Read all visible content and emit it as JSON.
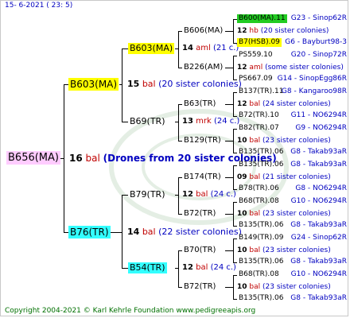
{
  "header": {
    "date": "15-  6-2021 (  23:  5)"
  },
  "footer": {
    "text": "Copyright 2004-2021 © Karl Kehrle Foundation    www.pedigreeapis.org"
  },
  "root": {
    "name": "B656(MA)",
    "num": "16",
    "sp": "bal",
    "col": "(Drones from 20 sister colonies)"
  },
  "g1": [
    {
      "name": "B603(MA)",
      "num": "15",
      "sp": "bal",
      "col": "(20 sister colonies)"
    },
    {
      "name": "B76(TR)",
      "num": "14",
      "sp": "bal",
      "col": "(22 sister colonies)"
    }
  ],
  "g2": [
    {
      "name": "B603(MA)",
      "num": "14",
      "sp": "aml",
      "col": "(21 c.)"
    },
    {
      "name": "B69(TR)",
      "num": "13",
      "sp": "mrk",
      "col": "(24 c.)"
    },
    {
      "name": "B79(TR)",
      "num": "12",
      "sp": "bal",
      "col": "(24 c.)"
    },
    {
      "name": "B54(TR)",
      "num": "12",
      "sp": "bal",
      "col": "(24 c.)"
    }
  ],
  "g3": [
    {
      "name": "B606(MA)",
      "num": "12",
      "sp": "hb",
      "col": "(20 sister colonies)"
    },
    {
      "name": "B226(AM)",
      "num": "12",
      "sp": "aml",
      "col": "(some sister colonies)"
    },
    {
      "name": "B63(TR)",
      "num": "12",
      "sp": "bal",
      "col": "(24 sister colonies)"
    },
    {
      "name": "B129(TR)",
      "num": "10",
      "sp": "bal",
      "col": "(23 sister colonies)"
    },
    {
      "name": "B174(TR)",
      "num": "09",
      "sp": "bal",
      "col": "(21 sister colonies)"
    },
    {
      "name": "B72(TR)",
      "num": "10",
      "sp": "bal",
      "col": "(23 sister colonies)"
    },
    {
      "name": "B70(TR)",
      "num": "10",
      "sp": "bal",
      "col": "(23 sister colonies)"
    },
    {
      "name": "B72(TR)",
      "num": "10",
      "sp": "bal",
      "col": "(23 sister colonies)"
    }
  ],
  "g4": [
    {
      "name": "B600(MA).11",
      "loc": "G23 - Sinop62R"
    },
    {
      "name": "B7(HSB).09",
      "loc": "G6 - Bayburt98-3"
    },
    {
      "name": "PS559.10",
      "loc": "G20 - Sinop72R"
    },
    {
      "name": "PS667.09",
      "loc": "G14 - SinopEgg86R"
    },
    {
      "name": "B137(TR).11",
      "loc": "G8 - Kangaroo98R"
    },
    {
      "name": "B72(TR).10",
      "loc": "G11 - NO6294R"
    },
    {
      "name": "B82(TR).07",
      "loc": "G9 - NO6294R"
    },
    {
      "name": "B135(TR).06",
      "loc": "G8 - Takab93aR"
    },
    {
      "name": "B135(TR).06",
      "loc": "G8 - Takab93aR"
    },
    {
      "name": "B78(TR).06",
      "loc": "G8 - NO6294R"
    },
    {
      "name": "B68(TR).08",
      "loc": "G10 - NO6294R"
    },
    {
      "name": "B135(TR).06",
      "loc": "G8 - Takab93aR"
    },
    {
      "name": "B149(TR).09",
      "loc": "G24 - Sinop62R"
    },
    {
      "name": "B135(TR).06",
      "loc": "G8 - Takab93aR"
    },
    {
      "name": "B68(TR).08",
      "loc": "G10 - NO6294R"
    },
    {
      "name": "B135(TR).06",
      "loc": "G8 - Takab93aR"
    }
  ]
}
